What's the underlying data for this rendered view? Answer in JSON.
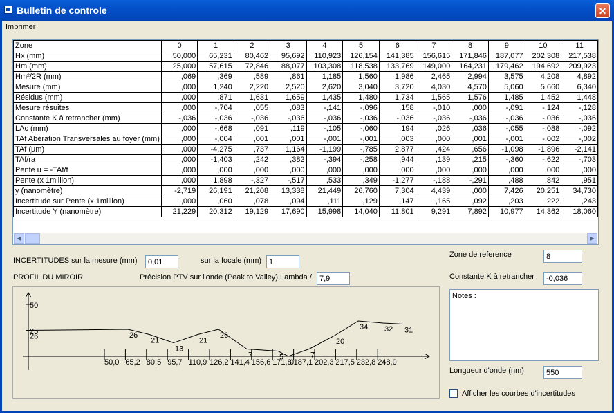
{
  "window": {
    "title": "Bulletin de controle",
    "close": "✕"
  },
  "menu": {
    "items": [
      "Imprimer"
    ]
  },
  "grid": {
    "row_label_header": "Zone",
    "zones": [
      "0",
      "1",
      "2",
      "3",
      "4",
      "5",
      "6",
      "7",
      "8",
      "9",
      "10",
      "11"
    ],
    "rows": [
      {
        "label": "Hx (mm)",
        "values": [
          "50,000",
          "65,231",
          "80,462",
          "95,692",
          "110,923",
          "126,154",
          "141,385",
          "156,615",
          "171,846",
          "187,077",
          "202,308",
          "217,538"
        ]
      },
      {
        "label": "Hm (mm)",
        "values": [
          "25,000",
          "57,615",
          "72,846",
          "88,077",
          "103,308",
          "118,538",
          "133,769",
          "149,000",
          "164,231",
          "179,462",
          "194,692",
          "209,923"
        ]
      },
      {
        "label": "Hm²/2R (mm)",
        "values": [
          ",069",
          ",369",
          ",589",
          ",861",
          "1,185",
          "1,560",
          "1,986",
          "2,465",
          "2,994",
          "3,575",
          "4,208",
          "4,892"
        ]
      },
      {
        "label": "Mesure (mm)",
        "values": [
          ",000",
          "1,240",
          "2,220",
          "2,520",
          "2,620",
          "3,040",
          "3,720",
          "4,030",
          "4,570",
          "5,060",
          "5,660",
          "6,340"
        ]
      },
      {
        "label": "Résidus (mm)",
        "values": [
          ",000",
          ",871",
          "1,631",
          "1,659",
          "1,435",
          "1,480",
          "1,734",
          "1,565",
          "1,576",
          "1,485",
          "1,452",
          "1,448"
        ]
      },
      {
        "label": "Mesure résuites",
        "values": [
          ",000",
          "-,704",
          ",055",
          ",083",
          "-,141",
          "-,096",
          ",158",
          "-,010",
          ",000",
          "-,091",
          "-,124",
          "-,128"
        ]
      },
      {
        "label": "Constante K à retrancher (mm)",
        "values": [
          "-,036",
          "-,036",
          "-,036",
          "-,036",
          "-,036",
          "-,036",
          "-,036",
          "-,036",
          "-,036",
          "-,036",
          "-,036",
          "-,036"
        ]
      },
      {
        "label": "LAc (mm)",
        "values": [
          ",000",
          "-,668",
          ",091",
          ",119",
          "-,105",
          "-,060",
          ",194",
          ",026",
          ",036",
          "-,055",
          "-,088",
          "-,092"
        ]
      },
      {
        "label": "TAf Abération Transversales au foyer (mm)",
        "values": [
          ",000",
          "-,004",
          ",001",
          ",001",
          "-,001",
          "-,001",
          ",003",
          ",000",
          ",001",
          "-,001",
          "-,002",
          "-,002"
        ]
      },
      {
        "label": "TAf (µm)",
        "values": [
          ",000",
          "-4,275",
          ",737",
          "1,164",
          "-1,199",
          "-,785",
          "2,877",
          ",424",
          ",656",
          "-1,098",
          "-1,896",
          "-2,141"
        ]
      },
      {
        "label": "TAf/ra",
        "values": [
          ",000",
          "-1,403",
          ",242",
          ",382",
          "-,394",
          "-,258",
          ",944",
          ",139",
          ",215",
          "-,360",
          "-,622",
          "-,703"
        ]
      },
      {
        "label": "Pente u = -TAf/f",
        "values": [
          ",000",
          ",000",
          ",000",
          ",000",
          ",000",
          ",000",
          ",000",
          ",000",
          ",000",
          ",000",
          ",000",
          ",000"
        ]
      },
      {
        "label": "Pente (x 1million)",
        "values": [
          ",000",
          "1,898",
          "-,327",
          "-,517",
          ",533",
          ",349",
          "-1,277",
          "-,188",
          "-,291",
          ",488",
          ",842",
          ",951"
        ]
      },
      {
        "label": "y  (nanomètre)",
        "values": [
          "-2,719",
          "26,191",
          "21,208",
          "13,338",
          "21,449",
          "26,760",
          "7,304",
          "4,439",
          ",000",
          "7,426",
          "20,251",
          "34,730"
        ]
      },
      {
        "label": "Incertitude sur Pente (x 1million)",
        "values": [
          ",000",
          ",060",
          ",078",
          ",094",
          ",111",
          ",129",
          ",147",
          ",165",
          ",092",
          ",203",
          ",222",
          ",243"
        ]
      },
      {
        "label": "Incertitude Y (nanomètre)",
        "values": [
          "21,229",
          "20,312",
          "19,129",
          "17,690",
          "15,998",
          "14,040",
          "11,801",
          "9,291",
          "7,892",
          "10,977",
          "14,362",
          "18,060"
        ]
      }
    ],
    "scroll_left": "◀",
    "scroll_right": "▶"
  },
  "form": {
    "incertitudes_label": "INCERTITUDES sur la mesure (mm)",
    "incertitudes_value": "0,01",
    "focale_label": "sur la focale (mm)",
    "focale_value": "1",
    "profil_label": "PROFIL DU MIROIR",
    "precision_label": "Précision PTV  sur l'onde  (Peak to Valley) Lambda /",
    "precision_value": "7,9",
    "zone_ref_label": "Zone de reference",
    "zone_ref_value": "8",
    "constante_label": "Constante K à retrancher",
    "constante_value": "-0,036",
    "notes_label": "Notes :",
    "longueur_label": "Longueur d'onde (nm)",
    "longueur_value": "550",
    "afficher_label": "Afficher les courbes d'incertitudes"
  },
  "chart_data": {
    "type": "line",
    "x_tick_labels": [
      "50,0",
      "65,2",
      "80,5",
      "95,7",
      "110,9",
      "126,2",
      "141,4",
      "156,6",
      "171,8",
      "187,1",
      "202,3",
      "217,5",
      "232,8",
      "248,0"
    ],
    "x": [
      50.0,
      65.2,
      80.5,
      95.7,
      110.9,
      126.2,
      141.4,
      156.6,
      171.8,
      187.1,
      202.3,
      217.5,
      232.8
    ],
    "values": [
      25,
      26,
      21,
      13,
      21,
      26,
      7,
      5,
      0,
      7,
      20,
      34,
      32,
      31
    ],
    "point_labels": [
      "26",
      "26",
      "21",
      "13",
      "21",
      "26",
      "7",
      "5",
      "0",
      "7",
      "20",
      "34",
      "32",
      "31"
    ],
    "y_tick_labels": [
      "50",
      "25"
    ],
    "ylim": [
      0,
      60
    ]
  }
}
